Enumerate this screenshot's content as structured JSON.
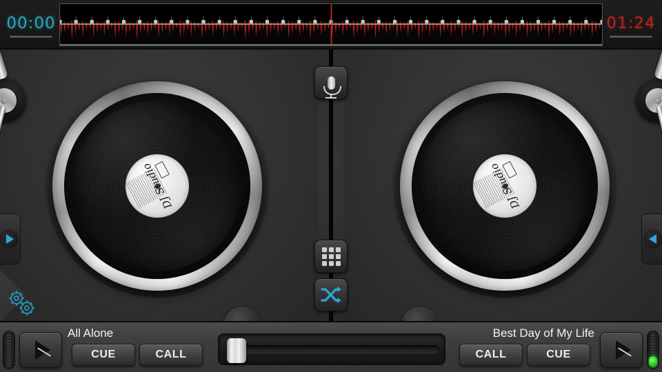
{
  "app": {
    "name": "DJ Studio"
  },
  "topbar": {
    "time_elapsed": "00:00",
    "time_remaining": "01:24",
    "elapsed_color": "#2aa6bf",
    "remaining_color": "#b5241f",
    "waveform": {
      "played_fraction": 0.0,
      "playhead_fraction": 0.5,
      "wave_color": "#b01a14",
      "played_bg": "#9a9a9a",
      "unplayed_bg": "#060606",
      "peaks": [
        0.62,
        0.44,
        0.3,
        0.78,
        0.52,
        0.4,
        0.66,
        0.35,
        0.28,
        0.7,
        0.48,
        0.33,
        0.58,
        0.41,
        0.26,
        0.74,
        0.55,
        0.38,
        0.63,
        0.45,
        0.31,
        0.8,
        0.5,
        0.36,
        0.6,
        0.42,
        0.29,
        0.68,
        0.47,
        0.34,
        0.56,
        0.39,
        0.25,
        0.72,
        0.53,
        0.37,
        0.64,
        0.43,
        0.3,
        0.76,
        0.51,
        0.35,
        0.59,
        0.4,
        0.27,
        0.69,
        0.46,
        0.32,
        0.61,
        0.44,
        0.28,
        0.82,
        0.54,
        0.38,
        0.65,
        0.42,
        0.31,
        0.71,
        0.49,
        0.33,
        0.57,
        0.41,
        0.26,
        0.75,
        0.52,
        0.36,
        0.62,
        0.45,
        0.3,
        0.79,
        0.5,
        0.34,
        0.58,
        0.43,
        0.29,
        0.67,
        0.48,
        0.32,
        0.6,
        0.4,
        0.27,
        0.73,
        0.53,
        0.37,
        0.66,
        0.44,
        0.31,
        0.77,
        0.51,
        0.35,
        0.55,
        0.39,
        0.25,
        0.7,
        0.47,
        0.33,
        0.63,
        0.42,
        0.28,
        0.81,
        0.52,
        0.36,
        0.59,
        0.41,
        0.3,
        0.68,
        0.46,
        0.34,
        0.64,
        0.43,
        0.26,
        0.74,
        0.5,
        0.38,
        0.61,
        0.45,
        0.32,
        0.78,
        0.49,
        0.29,
        0.56,
        0.4,
        0.35,
        0.72,
        0.54,
        0.31,
        0.65,
        0.44,
        0.27,
        0.69,
        0.48,
        0.37,
        0.6,
        0.42,
        0.33,
        0.76,
        0.51,
        0.28,
        0.62,
        0.46,
        0.3,
        0.71,
        0.53,
        0.36,
        0.58,
        0.39,
        0.34,
        0.67,
        0.47,
        0.25
      ],
      "beat_marker_count": 34,
      "beat_marker_color": "#c8c8c8"
    }
  },
  "decks": {
    "left": {
      "label_text": "DJ Studio",
      "turntable_name": "left-turntable",
      "add_music_icon": "music-note-add-icon",
      "flip_icon": "arrow-right-icon"
    },
    "right": {
      "label_text": "DJ Studio",
      "turntable_name": "right-turntable",
      "add_music_icon": "music-note-add-icon",
      "flip_icon": "arrow-left-icon"
    }
  },
  "center": {
    "mic_icon": "microphone-icon",
    "pads_icon": "grid-pads-icon",
    "shuffle_icon": "shuffle-icon",
    "shuffle_color": "#2da6d4"
  },
  "settings": {
    "icon": "gears-icon",
    "color": "#2b8fb0"
  },
  "bottom": {
    "left_deck": {
      "track_title": "All Alone",
      "buttons": [
        "CUE",
        "CALL"
      ],
      "play_icon": "play-icon",
      "pitch_led_on": false
    },
    "right_deck": {
      "track_title": "Best Day of My Life",
      "buttons": [
        "CALL",
        "CUE"
      ],
      "play_icon": "play-icon",
      "pitch_led_on": true,
      "led_color": "#2ddc28"
    },
    "crossfader": {
      "name": "crossfader",
      "position_fraction": 0.02
    }
  }
}
